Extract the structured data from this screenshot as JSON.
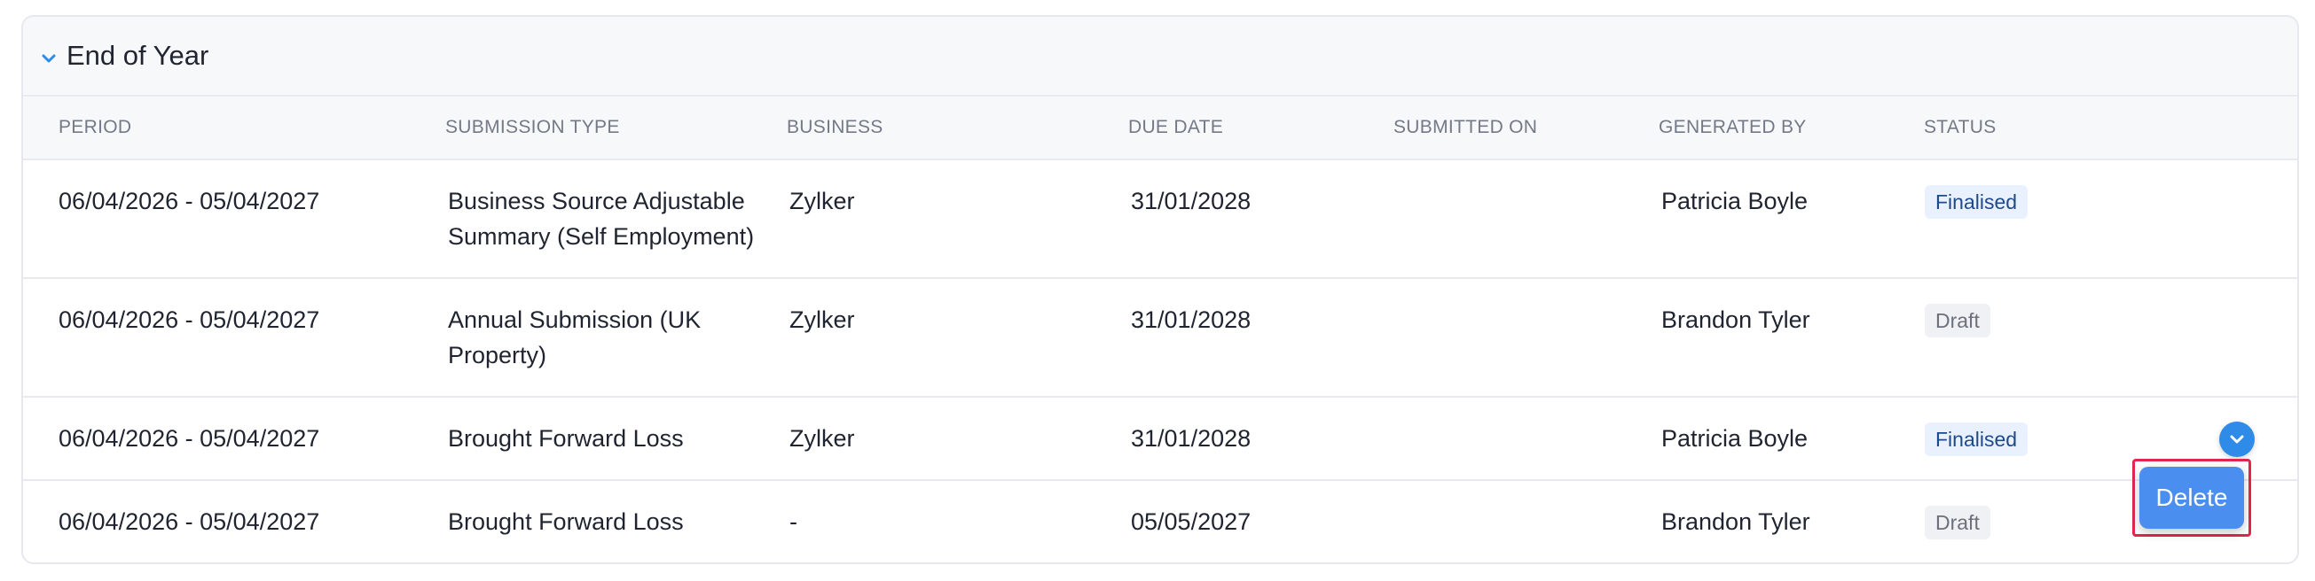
{
  "section": {
    "title": "End of Year",
    "icon": "chevron-down-icon",
    "accent": "#2f8be8"
  },
  "table": {
    "headers": {
      "period": "PERIOD",
      "submission_type": "SUBMISSION TYPE",
      "business": "BUSINESS",
      "due_date": "DUE DATE",
      "submitted_on": "SUBMITTED ON",
      "generated_by": "GENERATED BY",
      "status": "STATUS"
    },
    "rows": [
      {
        "period": "06/04/2026 - 05/04/2027",
        "submission_type_line1": "Business Source Adjustable",
        "submission_type_line2": "Summary (Self Employment)",
        "business": "Zylker",
        "due_date": "31/01/2028",
        "submitted_on": "",
        "generated_by": "Patricia Boyle",
        "status": "Finalised"
      },
      {
        "period": "06/04/2026 - 05/04/2027",
        "submission_type_line1": "Annual Submission (UK",
        "submission_type_line2": "Property)",
        "business": "Zylker",
        "due_date": "31/01/2028",
        "submitted_on": "",
        "generated_by": "Brandon Tyler",
        "status": "Draft"
      },
      {
        "period": "06/04/2026 - 05/04/2027",
        "submission_type_line1": "Brought Forward Loss",
        "submission_type_line2": "",
        "business": "Zylker",
        "due_date": "31/01/2028",
        "submitted_on": "",
        "generated_by": "Patricia Boyle",
        "status": "Finalised"
      },
      {
        "period": "06/04/2026 - 05/04/2027",
        "submission_type_line1": "Brought Forward Loss",
        "submission_type_line2": "",
        "business": "-",
        "due_date": "05/05/2027",
        "submitted_on": "",
        "generated_by": "Brandon Tyler",
        "status": "Draft"
      }
    ]
  },
  "row_action": {
    "icon": "chevron-down-icon",
    "color": "#2f8be8"
  },
  "menu": {
    "delete_label": "Delete",
    "highlight_color": "#e3264f"
  },
  "status_colors": {
    "Finalised": "#e8f1fd",
    "Draft": "#f0f1f4"
  }
}
